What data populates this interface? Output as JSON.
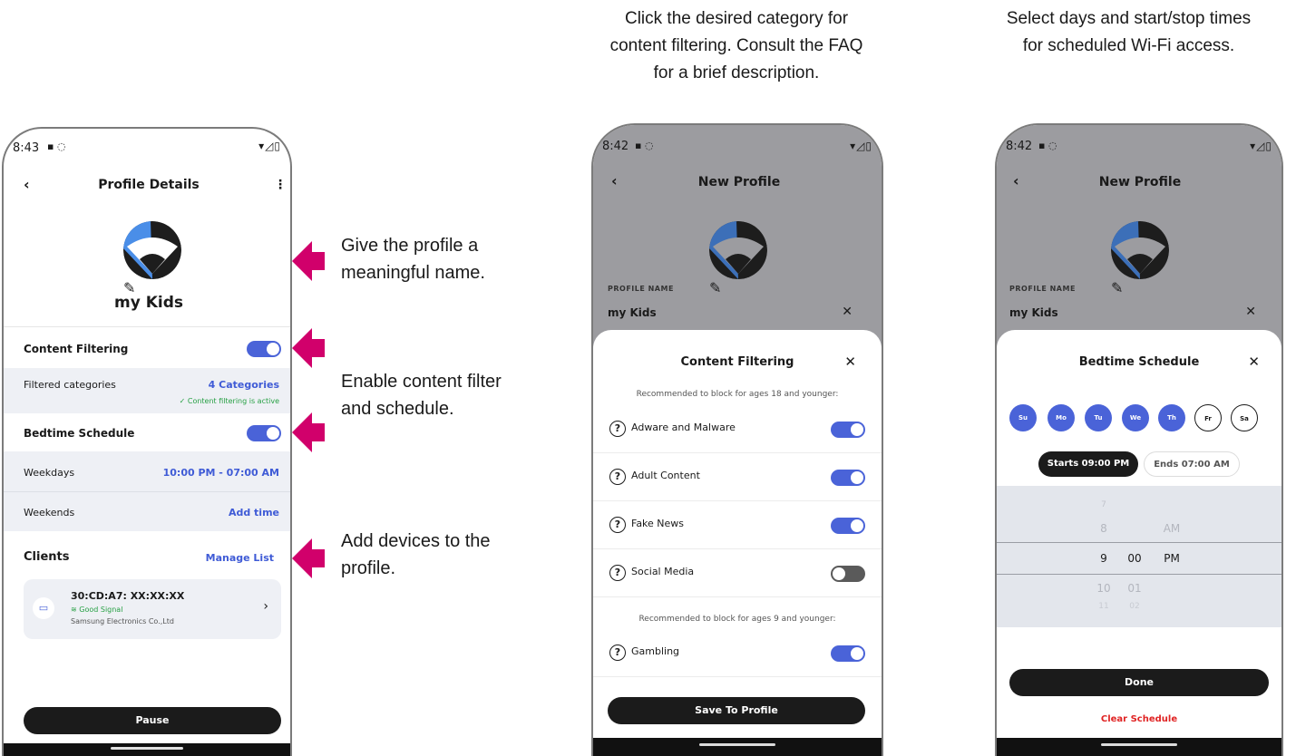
{
  "colors": {
    "accent": "#4a63d8",
    "arrow": "#d1006b",
    "success": "#27a044",
    "danger": "#e02424",
    "dark": "#1b1b1b"
  },
  "captions": {
    "content_filter": [
      "Click the desired category for",
      "content filtering. Consult the FAQ",
      "for a brief description."
    ],
    "schedule": [
      "Select days and start/stop times",
      "for scheduled Wi-Fi access."
    ]
  },
  "annotations": {
    "name": [
      "Give the profile a",
      "meaningful name."
    ],
    "enable": [
      "Enable content filter",
      "and schedule."
    ],
    "devices": [
      "Add devices to the",
      "profile."
    ]
  },
  "phone1": {
    "status_time": "8:43",
    "title": "Profile Details",
    "profile_name": "my Kids",
    "content_filtering_label": "Content Filtering",
    "filtered_categories_label": "Filtered categories",
    "filtered_categories_value": "4 Categories",
    "filter_active": "✓ Content filtering is active",
    "bedtime_label": "Bedtime Schedule",
    "weekdays_label": "Weekdays",
    "weekdays_value": "10:00 PM - 07:00 AM",
    "weekends_label": "Weekends",
    "weekends_value": "Add time",
    "clients_label": "Clients",
    "manage_list": "Manage List",
    "client": {
      "mac": "30:CD:A7: XX:XX:XX",
      "signal": "Good Signal",
      "vendor": "Samsung Electronics Co.,Ltd"
    },
    "pause": "Pause"
  },
  "phone2": {
    "status_time": "8:42",
    "title": "New Profile",
    "profile_name_label": "PROFILE NAME",
    "profile_name": "my Kids",
    "sheet_title": "Content Filtering",
    "hint_18": "Recommended to block for ages 18 and younger:",
    "categories": [
      {
        "label": "Adware and Malware",
        "enabled": true
      },
      {
        "label": "Adult Content",
        "enabled": true
      },
      {
        "label": "Fake News",
        "enabled": true
      },
      {
        "label": "Social Media",
        "enabled": false
      }
    ],
    "hint_9": "Recommended to block for ages 9 and younger:",
    "gambling": "Gambling",
    "save": "Save To Profile"
  },
  "phone3": {
    "status_time": "8:42",
    "title": "New Profile",
    "profile_name_label": "PROFILE NAME",
    "profile_name": "my Kids",
    "sheet_title": "Bedtime Schedule",
    "days": [
      {
        "label": "Su",
        "selected": true
      },
      {
        "label": "Mo",
        "selected": true
      },
      {
        "label": "Tu",
        "selected": true
      },
      {
        "label": "We",
        "selected": true
      },
      {
        "label": "Th",
        "selected": true
      },
      {
        "label": "Fr",
        "selected": false
      },
      {
        "label": "Sa",
        "selected": false
      }
    ],
    "starts": "Starts 09:00 PM",
    "ends": "Ends 07:00 AM",
    "picker": {
      "hour_above2": "7",
      "hour_above": "8",
      "ampm_above": "AM",
      "hour": "9",
      "minute": "00",
      "ampm": "PM",
      "hour_below": "10",
      "minute_below": "01",
      "hour_below2": "11",
      "minute_below2": "02"
    },
    "done": "Done",
    "clear": "Clear Schedule"
  }
}
